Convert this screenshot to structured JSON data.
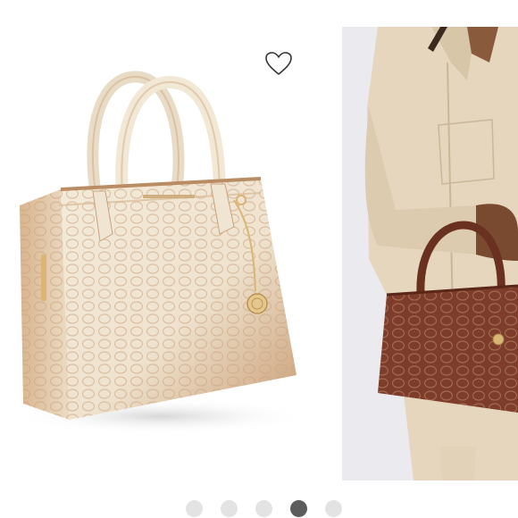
{
  "listing": {
    "images": [
      {
        "name": "handbag-front-photo",
        "colors": {
          "body": "#efe3cf",
          "edge": "#c99d74",
          "hardware": "#d9b676"
        }
      },
      {
        "name": "model-holding-bag-photo",
        "colors": {
          "shirt": "#e5d6bd",
          "bag": "#7e3d2a",
          "background": "#ebebef"
        }
      }
    ],
    "favorite_icon": "heart-outline-icon",
    "carousel": {
      "total": 5,
      "active_index": 4
    }
  }
}
